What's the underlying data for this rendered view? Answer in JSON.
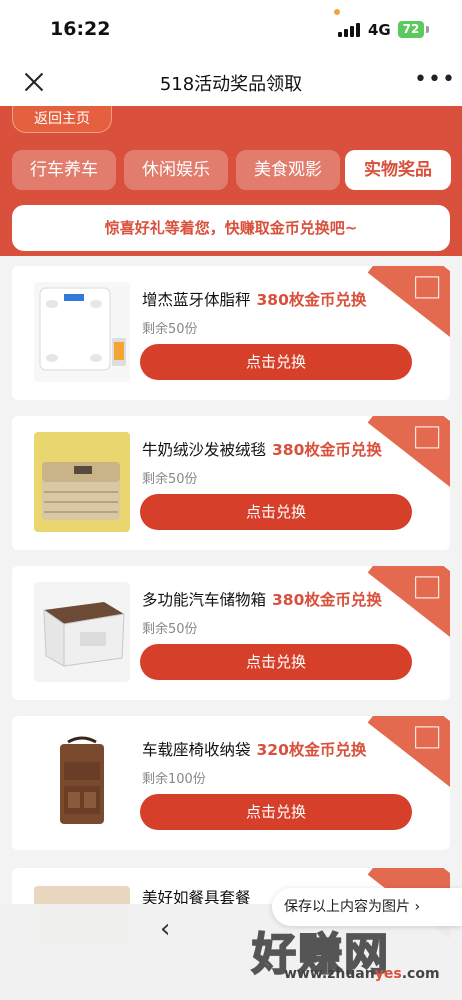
{
  "status": {
    "time": "16:22",
    "network": "4G",
    "battery": "72"
  },
  "nav": {
    "title": "518活动奖品领取"
  },
  "header": {
    "back_label": "返回主页",
    "tabs": [
      {
        "label": "行车养车"
      },
      {
        "label": "休闲娱乐"
      },
      {
        "label": "美食观影"
      },
      {
        "label": "实物奖品"
      }
    ],
    "promo": "惊喜好礼等着您，快赚取金币兑换吧~"
  },
  "prizes": [
    {
      "name": "增杰蓝牙体脂秤",
      "cost": "380枚金币兑换",
      "stock": "剩余50份",
      "button": "点击兑换"
    },
    {
      "name": "牛奶绒沙发被绒毯",
      "cost": "380枚金币兑换",
      "stock": "剩余50份",
      "button": "点击兑换"
    },
    {
      "name": "多功能汽车储物箱",
      "cost": "380枚金币兑换",
      "stock": "剩余50份",
      "button": "点击兑换"
    },
    {
      "name": "车载座椅收纳袋",
      "cost": "320枚金币兑换",
      "stock": "剩余100份",
      "button": "点击兑换"
    },
    {
      "name": "美好如餐具套餐"
    }
  ],
  "save_image": "保存以上内容为图片 ›",
  "watermark": {
    "text": "好赚网",
    "url_a": "www.zhuan",
    "url_b": "yes",
    "url_c": ".com"
  },
  "colors": {
    "accent": "#d9503c",
    "button": "#d6402a"
  }
}
